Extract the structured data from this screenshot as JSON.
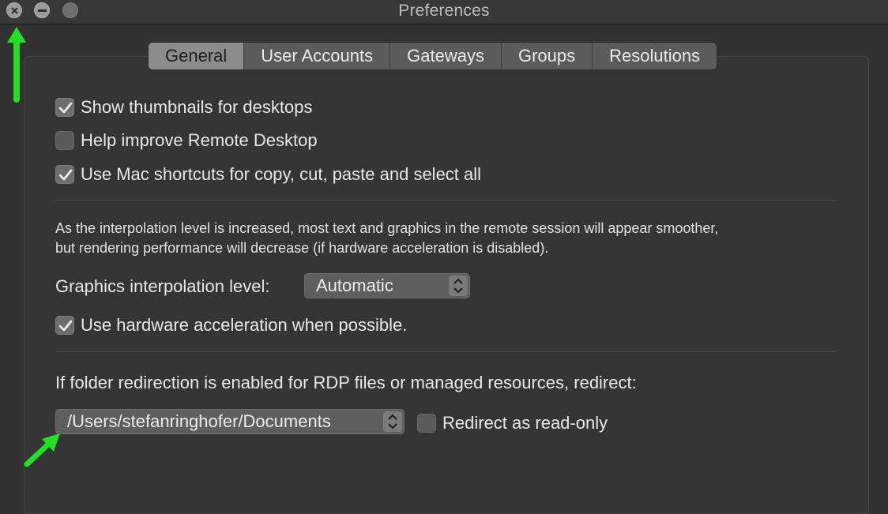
{
  "window": {
    "title": "Preferences"
  },
  "tabs": [
    {
      "label": "General",
      "active": true
    },
    {
      "label": "User Accounts",
      "active": false
    },
    {
      "label": "Gateways",
      "active": false
    },
    {
      "label": "Groups",
      "active": false
    },
    {
      "label": "Resolutions",
      "active": false
    }
  ],
  "general": {
    "show_thumbnails": {
      "label": "Show thumbnails for desktops",
      "checked": true
    },
    "help_improve": {
      "label": "Help improve Remote Desktop",
      "checked": false
    },
    "mac_shortcuts": {
      "label": "Use Mac shortcuts for copy, cut, paste and select all",
      "checked": true
    },
    "interpolation_description_line1": "As the interpolation level is increased, most text and graphics in the remote session will appear smoother,",
    "interpolation_description_line2": "but rendering performance will decrease (if hardware acceleration is disabled).",
    "interpolation_label": "Graphics interpolation level:",
    "interpolation_value": "Automatic",
    "hw_accel": {
      "label": "Use hardware acceleration when possible.",
      "checked": true
    },
    "redirect_label": "If folder redirection is enabled for RDP files or managed resources, redirect:",
    "redirect_path": "/Users/stefanringhofer/Documents",
    "read_only": {
      "label": "Redirect as read-only",
      "checked": false
    }
  },
  "colors": {
    "background": "#323232",
    "annotation_arrow": "#22e022",
    "active_tab": "#8c8c8c"
  },
  "icons": [
    "close-icon",
    "minimize-icon",
    "zoom-icon",
    "checkmark-icon",
    "updown-chevron-icon",
    "annotation-arrow-icon"
  ]
}
